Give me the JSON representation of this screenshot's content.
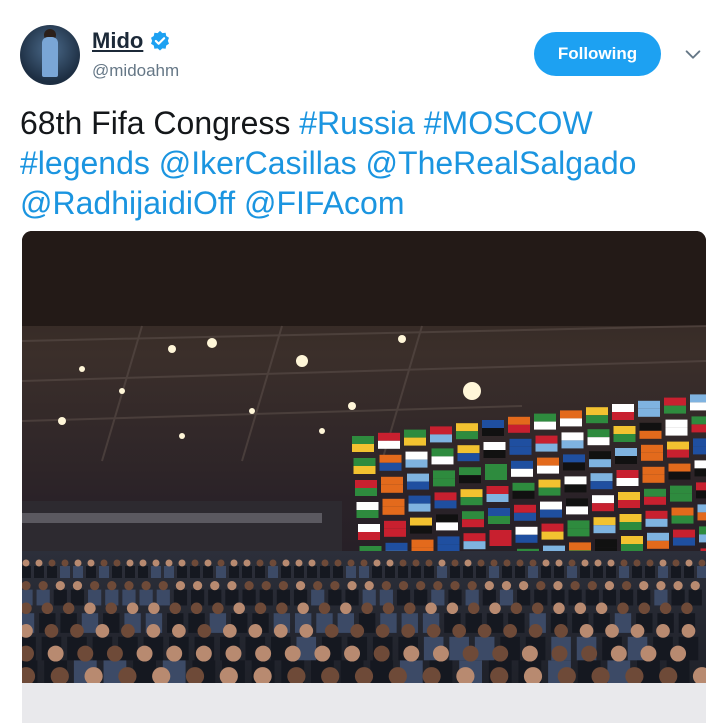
{
  "user": {
    "display_name": "Mido",
    "handle": "@midoahm",
    "verified_icon": "verified-badge-icon",
    "avatar_icon": "avatar-image"
  },
  "follow_button": {
    "label": "Following"
  },
  "menu_icon": "chevron-down-icon",
  "tweet": {
    "parts": [
      {
        "text": "68th Fifa Congress ",
        "type": "text"
      },
      {
        "text": "#Russia",
        "type": "hashtag"
      },
      {
        "text": " ",
        "type": "text"
      },
      {
        "text": "#MOSCOW",
        "type": "hashtag"
      },
      {
        "text": " ",
        "type": "text"
      },
      {
        "text": "#legends",
        "type": "hashtag"
      },
      {
        "text": " ",
        "type": "text"
      },
      {
        "text": "@IkerCasillas",
        "type": "mention"
      },
      {
        "text": " ",
        "type": "text"
      },
      {
        "text": "@TheRealSalgado",
        "type": "mention"
      },
      {
        "text": " ",
        "type": "text"
      },
      {
        "text": "@RadhijaidiOff",
        "type": "mention"
      },
      {
        "text": " ",
        "type": "text"
      },
      {
        "text": "@FIFAcom",
        "type": "mention"
      }
    ]
  },
  "photo": {
    "description_icon": "congress-hall-photo"
  },
  "colors": {
    "accent": "#1da1f2",
    "link": "#1b95e0",
    "text": "#14171a",
    "secondary": "#657786"
  }
}
